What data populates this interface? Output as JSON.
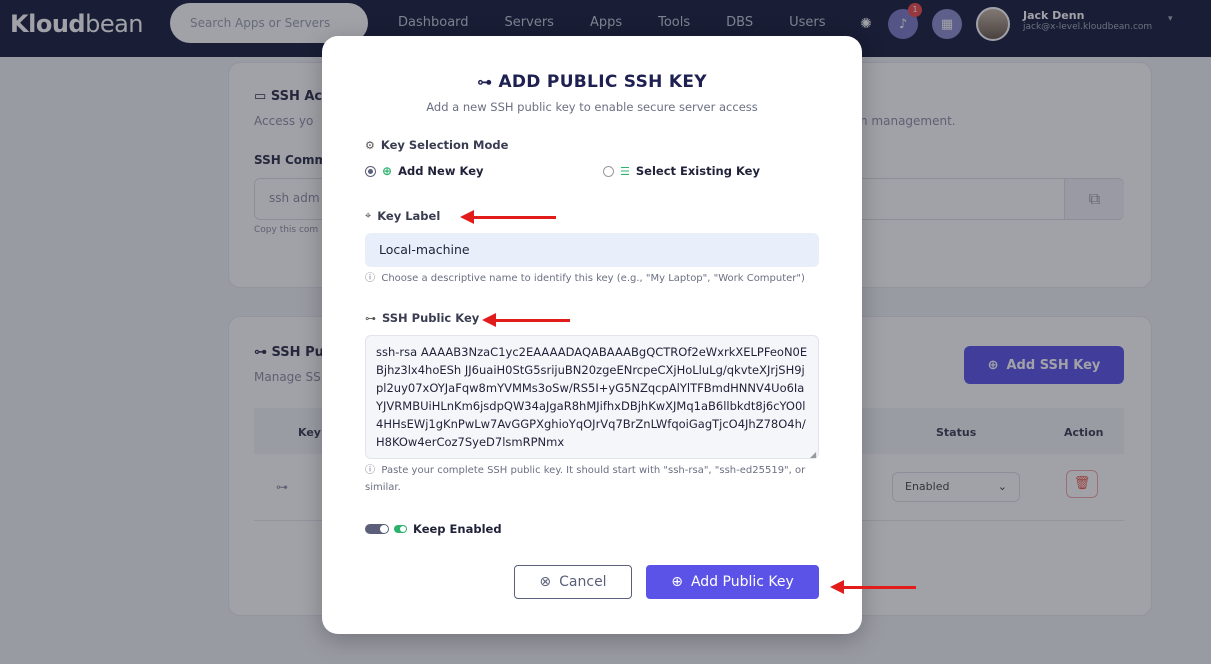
{
  "navbar": {
    "logo_bold": "Kloud",
    "logo_light": "bean",
    "search_placeholder": "Search Apps or Servers",
    "items": [
      "Dashboard",
      "Servers",
      "Apps",
      "Tools",
      "DBS",
      "Users"
    ],
    "notification_count": "1",
    "user_name": "Jack Denn",
    "user_email": "jack@x-level.kloudbean.com"
  },
  "background": {
    "ssh_access_title": "SSH Ac",
    "ssh_access_desc": "Access yo",
    "ssh_access_desc_tail": "n management.",
    "ssh_command_label": "SSH Comm",
    "ssh_command_value": "ssh adm",
    "copy_note": "Copy this com",
    "ssh_keys_title": "SSH Pu",
    "ssh_keys_desc": "Manage SS",
    "add_ssh_key_label": "Add SSH Key",
    "table_headers": {
      "key": "Key",
      "status": "Status",
      "action": "Action"
    },
    "row_status": "Enabled"
  },
  "modal": {
    "title": "ADD PUBLIC SSH KEY",
    "subtitle": "Add a new SSH public key to enable secure server access",
    "mode_label": "Key Selection Mode",
    "mode_options": [
      "Add New Key",
      "Select Existing Key"
    ],
    "key_label_label": "Key Label",
    "key_label_value": "Local-machine",
    "key_label_help": "Choose a descriptive name to identify this key (e.g., \"My Laptop\", \"Work Computer\")",
    "ssh_key_label": "SSH Public Key",
    "ssh_key_value": "ssh-rsa AAAAB3NzaC1yc2EAAAADAQABAAABgQCTROf2eWxrkXELPFeoN0EBjhz3lx4hoESh JJ6uaiH0StG5srijuBN20zgeENrcpeCXjHoLluLg/qkvteXJrjSH9jpl2uy07xOYJaFqw8mYVMMs3oSw/RS5I+yG5NZqcpAlYlTFBmdHNNV4Uo6IaYJVRMBUiHLnKm6jsdpQW34aJgaR8hMJifhxDBjhKwXJMq1aB6llbkdt8j6cYO0l4HHsEWj1gKnPwLw7AvGGPXghioYqOJrVq7BrZnLWfqoiGagTjcO4JhZ78O4h/H8KOw4erCoz7SyeD7lsmRPNmx",
    "ssh_key_help": "Paste your complete SSH public key. It should start with \"ssh-rsa\", \"ssh-ed25519\", or similar.",
    "keep_enabled_label": "Keep Enabled",
    "cancel_label": "Cancel",
    "add_label": "Add Public Key"
  }
}
